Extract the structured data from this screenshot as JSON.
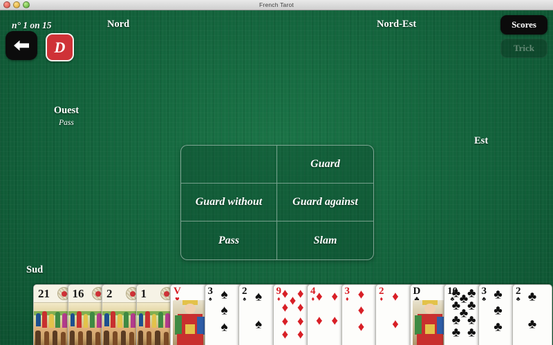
{
  "window": {
    "title": "French Tarot",
    "controls": [
      "close",
      "minimize",
      "zoom"
    ]
  },
  "hud": {
    "deal_counter": "n° 1 on 15",
    "back_button_label": "back-arrow",
    "logo_label": "D"
  },
  "buttons": {
    "scores": {
      "label": "Scores",
      "enabled": true
    },
    "trick": {
      "label": "Trick",
      "enabled": false
    }
  },
  "seats": [
    {
      "id": "nord",
      "name": "Nord",
      "bid": ""
    },
    {
      "id": "nord-est",
      "name": "Nord-Est",
      "bid": ""
    },
    {
      "id": "est",
      "name": "Est",
      "bid": ""
    },
    {
      "id": "ouest",
      "name": "Ouest",
      "bid": "Pass"
    },
    {
      "id": "sud",
      "name": "Sud",
      "bid": ""
    }
  ],
  "bid_grid": {
    "cells": [
      {
        "label": "",
        "empty": true
      },
      {
        "label": "Guard",
        "empty": false
      },
      {
        "label": "Guard without",
        "empty": false
      },
      {
        "label": "Guard against",
        "empty": false
      },
      {
        "label": "Pass",
        "empty": false
      },
      {
        "label": "Slam",
        "empty": false
      }
    ]
  },
  "hand": {
    "cards": [
      {
        "rank": "21",
        "suit": "trump",
        "symbol": "",
        "color": "blk",
        "pips": 0
      },
      {
        "rank": "16",
        "suit": "trump",
        "symbol": "",
        "color": "blk",
        "pips": 0
      },
      {
        "rank": "2",
        "suit": "trump",
        "symbol": "",
        "color": "blk",
        "pips": 0
      },
      {
        "rank": "1",
        "suit": "trump",
        "symbol": "",
        "color": "blk",
        "pips": 0
      },
      {
        "rank": "V",
        "suit": "hearts",
        "symbol": "♥",
        "color": "red",
        "pips": 0
      },
      {
        "rank": "3",
        "suit": "spades",
        "symbol": "♠",
        "color": "blk",
        "pips": 3
      },
      {
        "rank": "2",
        "suit": "spades",
        "symbol": "♠",
        "color": "blk",
        "pips": 2
      },
      {
        "rank": "9",
        "suit": "diamonds",
        "symbol": "♦",
        "color": "red",
        "pips": 9
      },
      {
        "rank": "4",
        "suit": "diamonds",
        "symbol": "♦",
        "color": "red",
        "pips": 4
      },
      {
        "rank": "3",
        "suit": "diamonds",
        "symbol": "♦",
        "color": "red",
        "pips": 3
      },
      {
        "rank": "2",
        "suit": "diamonds",
        "symbol": "♦",
        "color": "red",
        "pips": 2
      },
      {
        "rank": "D",
        "suit": "clubs",
        "symbol": "♣",
        "color": "blk",
        "pips": 0
      },
      {
        "rank": "10",
        "suit": "clubs",
        "symbol": "♣",
        "color": "blk",
        "pips": 10
      },
      {
        "rank": "3",
        "suit": "clubs",
        "symbol": "♣",
        "color": "blk",
        "pips": 3
      },
      {
        "rank": "2",
        "suit": "clubs",
        "symbol": "♣",
        "color": "blk",
        "pips": 2
      }
    ]
  },
  "colors": {
    "felt": "#15693f",
    "logo_red": "#cf3237",
    "card_red": "#d81f26",
    "button_black": "#0b0b0b"
  }
}
